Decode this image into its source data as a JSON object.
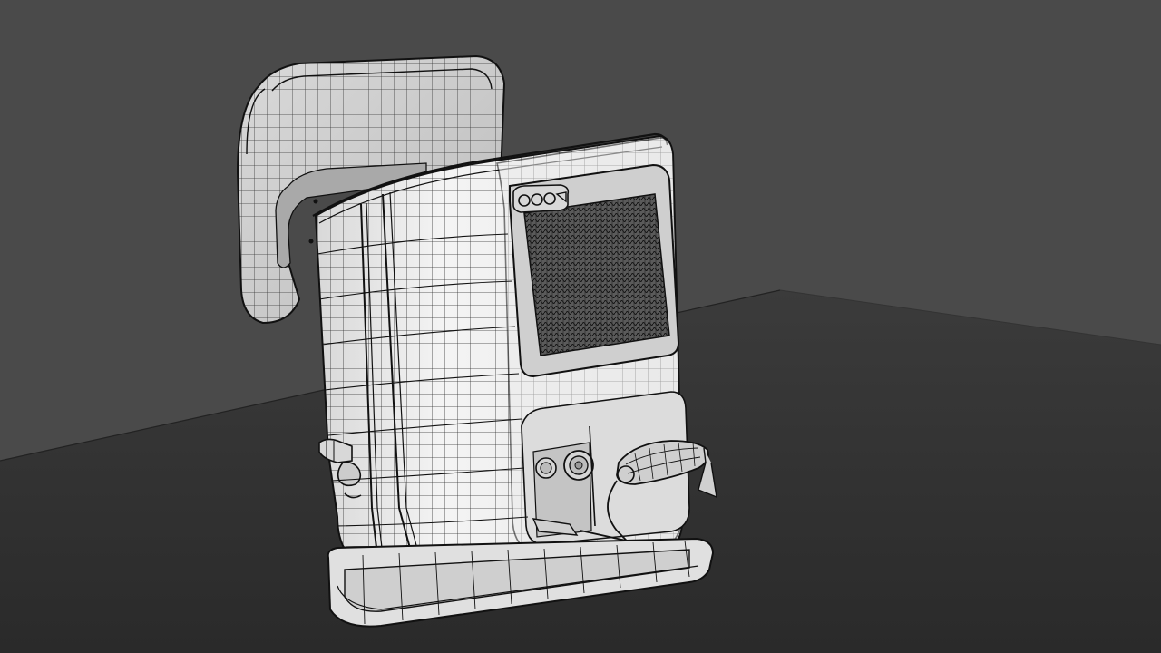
{
  "scene": {
    "subject": "wireframe-3d-render",
    "colors": {
      "wall": "#4b4b4b",
      "floor_top": "#3a3a3a",
      "floor_bottom": "#2c2c2c",
      "mesh_surface": "#eeeeee",
      "mesh_shadow": "#bdbdbd",
      "wire": "#1a1a1a",
      "grille": "#2e2e2e"
    }
  }
}
